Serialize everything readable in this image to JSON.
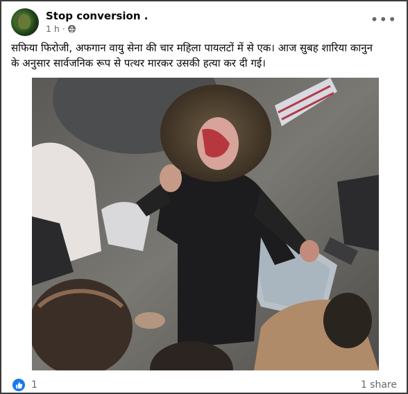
{
  "post": {
    "author": "Stop conversion .",
    "time": "1 h ·",
    "privacy_icon": "globe-icon",
    "more_icon": "more-options-icon",
    "caption_line1": "सफिया फिरोजी, अफगान वायु सेना की चार महिला पायलटों में से एक। आज सुबह शारिया कानुन",
    "caption_line2": "के अनुसार  सार्वजनिक रूप से पत्थर मारकर उसकी हत्या कर दी गई।"
  },
  "footer": {
    "reaction_icon": "like-reaction-icon",
    "reaction_count": "1",
    "shares": "1 share"
  },
  "colors": {
    "accent": "#1877f2",
    "secondary_text": "#65676b"
  }
}
